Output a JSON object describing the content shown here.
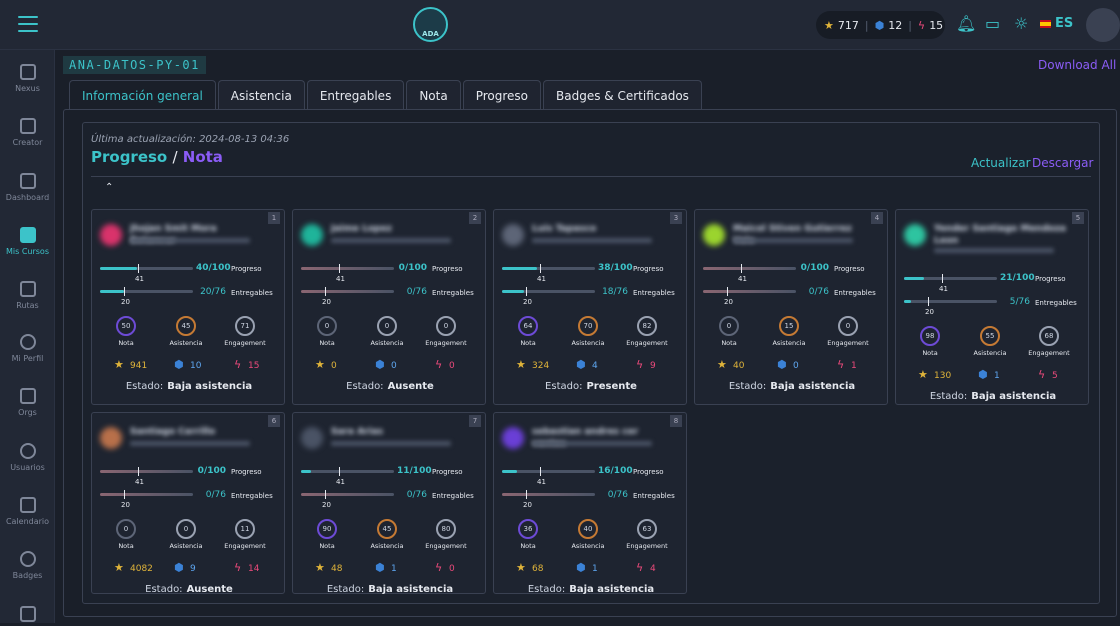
{
  "header": {
    "logo_text": "ADA",
    "stars": "717",
    "gems": "12",
    "bolts": "15",
    "lang": "ES"
  },
  "sidebar": [
    {
      "label": "Nexus"
    },
    {
      "label": "Creator"
    },
    {
      "label": "Dashboard"
    },
    {
      "label": "Mis Cursos"
    },
    {
      "label": "Rutas"
    },
    {
      "label": "Mi Perfil"
    },
    {
      "label": "Orgs"
    },
    {
      "label": "Usuarios"
    },
    {
      "label": "Calendario"
    },
    {
      "label": "Badges"
    }
  ],
  "course_code": "ANA-DATOS-PY-01",
  "download_all": "Download All",
  "tabs": [
    "Información general",
    "Asistencia",
    "Entregables",
    "Nota",
    "Progreso",
    "Badges & Certificados"
  ],
  "panel": {
    "updated": "Última actualización: 2024-08-13 04:36",
    "title_a": "Progreso",
    "title_sep": "/",
    "title_b": "Nota",
    "actualizar": "Actualizar",
    "descargar": "Descargar"
  },
  "labels": {
    "progreso": "Progreso",
    "entregables": "Entregables",
    "nota": "Nota",
    "asistencia": "Asistencia",
    "engagement": "Engagement",
    "estado": "Estado:",
    "mark_top": "41",
    "mark_bottom": "20"
  },
  "students": [
    {
      "n": "1",
      "name": "Jhojan Smit Mora Betancur",
      "prog": "40/100",
      "progv": 0.4,
      "ent": "20/76",
      "entv": 0.26,
      "nota": "50",
      "asis": "45",
      "eng": "71",
      "stars": "941",
      "gems": "10",
      "bolts": "15",
      "estado": "Baja asistencia",
      "color": "#d9336b"
    },
    {
      "n": "2",
      "name": "Jaime Lopez",
      "prog": "0/100",
      "progv": 0,
      "ent": "0/76",
      "entv": 0,
      "nota": "0",
      "asis": "0",
      "eng": "0",
      "stars": "0",
      "gems": "0",
      "bolts": "0",
      "estado": "Ausente",
      "color": "#1fb49a"
    },
    {
      "n": "3",
      "name": "Luis Tapasco",
      "prog": "38/100",
      "progv": 0.38,
      "ent": "18/76",
      "entv": 0.24,
      "nota": "64",
      "asis": "70",
      "eng": "82",
      "stars": "324",
      "gems": "4",
      "bolts": "9",
      "estado": "Presente",
      "color": "#5d6577"
    },
    {
      "n": "4",
      "name": "Maicol Stiven Gutierrez Valo",
      "prog": "0/100",
      "progv": 0,
      "ent": "0/76",
      "entv": 0,
      "nota": "0",
      "asis": "15",
      "eng": "0",
      "stars": "40",
      "gems": "0",
      "bolts": "1",
      "estado": "Baja asistencia",
      "color": "#9bd42e"
    },
    {
      "n": "5",
      "name": "Yender Santiago Mendoza Leon",
      "prog": "21/100",
      "progv": 0.21,
      "ent": "5/76",
      "entv": 0.07,
      "nota": "98",
      "asis": "55",
      "eng": "68",
      "stars": "130",
      "gems": "1",
      "bolts": "5",
      "estado": "Baja asistencia",
      "color": "#2ec4a0"
    },
    {
      "n": "6",
      "name": "Santiago Carrillo",
      "prog": "0/100",
      "progv": 0,
      "ent": "0/76",
      "entv": 0,
      "nota": "0",
      "asis": "0",
      "eng": "11",
      "stars": "4082",
      "gems": "9",
      "bolts": "14",
      "estado": "Ausente",
      "color": "#b8704a"
    },
    {
      "n": "7",
      "name": "Sara Arias",
      "prog": "11/100",
      "progv": 0.11,
      "ent": "0/76",
      "entv": 0,
      "nota": "90",
      "asis": "45",
      "eng": "80",
      "stars": "48",
      "gems": "1",
      "bolts": "0",
      "estado": "Baja asistencia",
      "color": "#4a5365"
    },
    {
      "n": "8",
      "name": "sebastian andres cer vantes",
      "prog": "16/100",
      "progv": 0.16,
      "ent": "0/76",
      "entv": 0,
      "nota": "36",
      "asis": "40",
      "eng": "63",
      "stars": "68",
      "gems": "1",
      "bolts": "4",
      "estado": "Baja asistencia",
      "color": "#6a3fd6"
    }
  ]
}
